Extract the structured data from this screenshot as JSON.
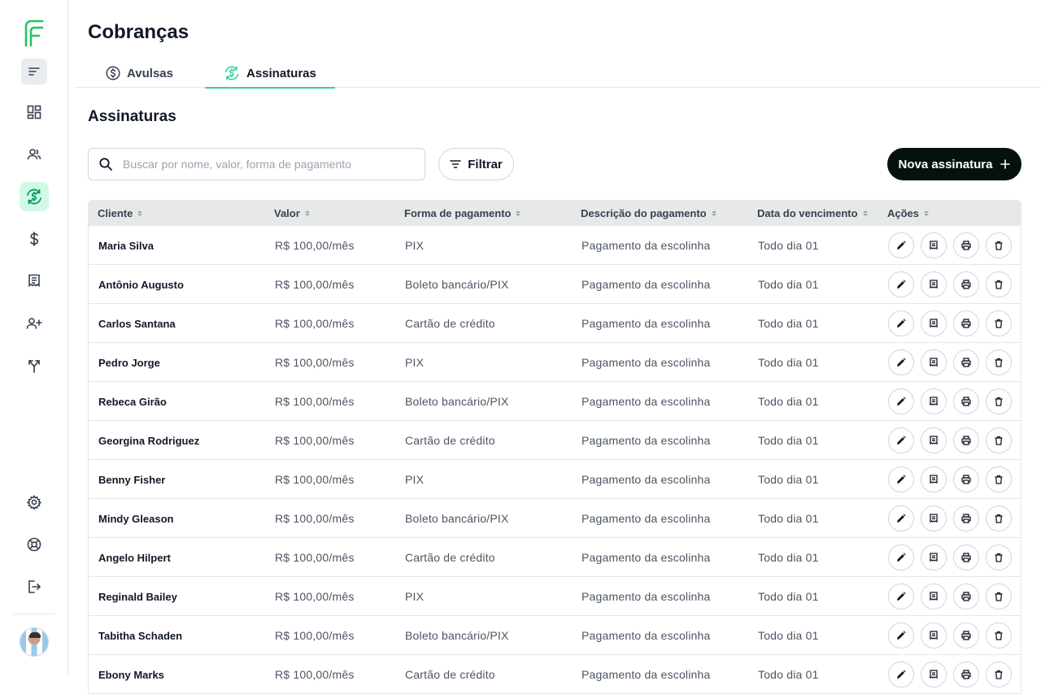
{
  "page": {
    "title": "Cobranças"
  },
  "tabs": [
    {
      "label": "Avulsas",
      "icon": "dollar-circle-icon"
    },
    {
      "label": "Assinaturas",
      "icon": "recurring-dollar-icon",
      "active": true
    }
  ],
  "section": {
    "title": "Assinaturas"
  },
  "search": {
    "placeholder": "Buscar por nome, valor, forma de pagamento",
    "value": ""
  },
  "filter": {
    "label": "Filtrar"
  },
  "new_button": {
    "label": "Nova assinatura"
  },
  "sidebar": {
    "items": [
      {
        "name": "dashboard",
        "icon": "dashboard-icon"
      },
      {
        "name": "clientes",
        "icon": "users-icon"
      },
      {
        "name": "cobrancas",
        "icon": "recurring-dollar-icon",
        "active": true
      },
      {
        "name": "financeiro",
        "icon": "dollar-icon"
      },
      {
        "name": "recibos",
        "icon": "receipt-icon"
      },
      {
        "name": "convidar",
        "icon": "user-plus-icon"
      },
      {
        "name": "integracoes",
        "icon": "merge-icon"
      },
      {
        "name": "configuracoes",
        "icon": "gear-icon"
      },
      {
        "name": "suporte",
        "icon": "lifebuoy-icon"
      },
      {
        "name": "sair",
        "icon": "logout-icon"
      }
    ]
  },
  "table": {
    "columns": [
      "Cliente",
      "Valor",
      "Forma de pagamento",
      "Descrição do pagamento",
      "Data do vencimento",
      "Ações"
    ],
    "rows": [
      {
        "cliente": "Maria Silva",
        "valor": "R$ 100,00/mês",
        "forma": "PIX",
        "descricao": "Pagamento da escolinha",
        "vencimento": "Todo dia 01"
      },
      {
        "cliente": "Antônio Augusto",
        "valor": "R$ 100,00/mês",
        "forma": "Boleto bancário/PIX",
        "descricao": "Pagamento da escolinha",
        "vencimento": "Todo dia 01"
      },
      {
        "cliente": "Carlos Santana",
        "valor": "R$ 100,00/mês",
        "forma": "Cartão de crédito",
        "descricao": "Pagamento da escolinha",
        "vencimento": "Todo dia 01"
      },
      {
        "cliente": "Pedro Jorge",
        "valor": "R$ 100,00/mês",
        "forma": "PIX",
        "descricao": "Pagamento da escolinha",
        "vencimento": "Todo dia 01"
      },
      {
        "cliente": "Rebeca Girão",
        "valor": "R$ 100,00/mês",
        "forma": "Boleto bancário/PIX",
        "descricao": "Pagamento da escolinha",
        "vencimento": "Todo dia 01"
      },
      {
        "cliente": "Georgina Rodriguez",
        "valor": "R$ 100,00/mês",
        "forma": "Cartão de crédito",
        "descricao": "Pagamento da escolinha",
        "vencimento": "Todo dia 01"
      },
      {
        "cliente": "Benny Fisher",
        "valor": "R$ 100,00/mês",
        "forma": "PIX",
        "descricao": "Pagamento da escolinha",
        "vencimento": "Todo dia 01"
      },
      {
        "cliente": "Mindy Gleason",
        "valor": "R$ 100,00/mês",
        "forma": "Boleto bancário/PIX",
        "descricao": "Pagamento da escolinha",
        "vencimento": "Todo dia 01"
      },
      {
        "cliente": "Angelo Hilpert",
        "valor": "R$ 100,00/mês",
        "forma": "Cartão de crédito",
        "descricao": "Pagamento da escolinha",
        "vencimento": "Todo dia 01"
      },
      {
        "cliente": "Reginald Bailey",
        "valor": "R$ 100,00/mês",
        "forma": "PIX",
        "descricao": "Pagamento da escolinha",
        "vencimento": "Todo dia 01"
      },
      {
        "cliente": "Tabitha Schaden",
        "valor": "R$ 100,00/mês",
        "forma": "Boleto bancário/PIX",
        "descricao": "Pagamento da escolinha",
        "vencimento": "Todo dia 01"
      },
      {
        "cliente": "Ebony Marks",
        "valor": "R$ 100,00/mês",
        "forma": "Cartão de crédito",
        "descricao": "Pagamento da escolinha",
        "vencimento": "Todo dia 01"
      }
    ],
    "row_actions": [
      "edit-icon",
      "receipt-icon",
      "print-icon",
      "trash-icon"
    ]
  },
  "colors": {
    "accent": "#34d399",
    "accent_bg": "#d1fae5",
    "primary_button": "#06110d",
    "header_bg": "#e7e9e8"
  }
}
